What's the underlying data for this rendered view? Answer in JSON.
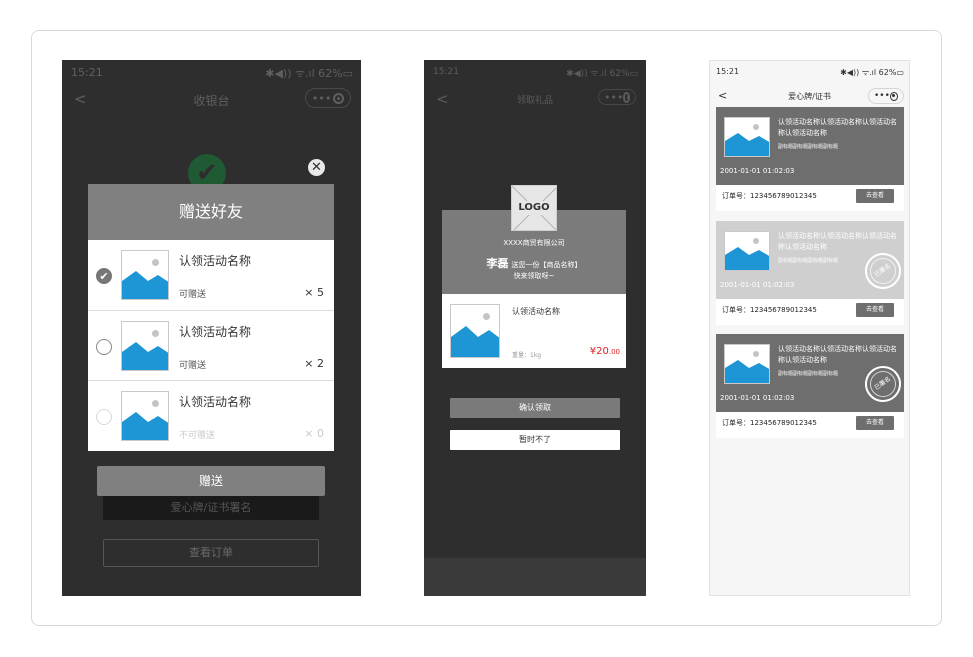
{
  "phone1": {
    "status_time": "15:21",
    "status_icons": "✱◀)) ᯤ.ıl 62%▭",
    "back_glyph": "<",
    "nav_title": "收银台",
    "capsule_dots": "•••",
    "success_glyph": "✔",
    "close_glyph": "✕",
    "modal_title": "赠送好友",
    "gifts": [
      {
        "name": "认领活动名称",
        "state": "可赠送",
        "qty": "× 5",
        "selected": true,
        "radio_glyph": "✔"
      },
      {
        "name": "认领活动名称",
        "state": "可赠送",
        "qty": "× 2",
        "selected": false,
        "radio_glyph": ""
      },
      {
        "name": "认领活动名称",
        "state": "不可赠送",
        "qty": "× 0",
        "selected": false,
        "radio_glyph": ""
      }
    ],
    "gift_button": "赠送",
    "sign_button": "爱心牌/证书署名",
    "order_button": "查看订单"
  },
  "phone2": {
    "status_time": "15:21",
    "status_icons": "✱◀)) ᯤ.ıl 62%▭",
    "back_glyph": "<",
    "nav_title": "领取礼品",
    "capsule_dots": "•••",
    "logo_text": "LOGO",
    "company": "XXXX商贸有限公司",
    "sender_name": "李磊",
    "sender_text": "送您一份【商品名称】",
    "sender_sub": "快来领取呀~",
    "item_name": "认领活动名称",
    "item_weight": "重量：1kg",
    "price_main": "¥20",
    "price_decimal": ".00",
    "confirm_button": "确认领取",
    "later_button": "暂时不了"
  },
  "phone3": {
    "status_time": "15:21",
    "status_icons": "✱◀)) ᯤ.ıl 62%▭",
    "back_glyph": "<",
    "nav_title": "爱心牌/证书",
    "capsule_dots": "•••",
    "certificates": [
      {
        "name": "认领活动名称认领活动名称认领活动名称认领活动名称",
        "subtitle": "副标题副标题副标题副标题",
        "time": "2001-01-01 01:02:03",
        "order_label": "订单号：123456789012345",
        "view_button": "去查看",
        "stamp": ""
      },
      {
        "name": "认领活动名称认领活动名称认领活动名称认领活动名称",
        "subtitle": "副标题副标题副标题副标题",
        "time": "2001-01-01 01:02:03",
        "order_label": "订单号：123456789012345",
        "view_button": "去查看",
        "stamp": "已署名"
      },
      {
        "name": "认领活动名称认领活动名称认领活动名称认领活动名称",
        "subtitle": "副标题副标题副标题副标题",
        "time": "2001-01-01 01:02:03",
        "order_label": "订单号：123456789012345",
        "view_button": "去查看",
        "stamp": "已署名"
      }
    ]
  },
  "colors": {
    "dark_bg": "#2e2e2e",
    "modal_header": "#808080",
    "image_blue": "#1e95d4",
    "price_red": "#d9231f",
    "success_green": "#1f5a34"
  },
  "icons": {
    "image_placeholder": "image-icon",
    "check": "check-icon",
    "close": "close-icon",
    "stamp": "stamp-icon"
  }
}
